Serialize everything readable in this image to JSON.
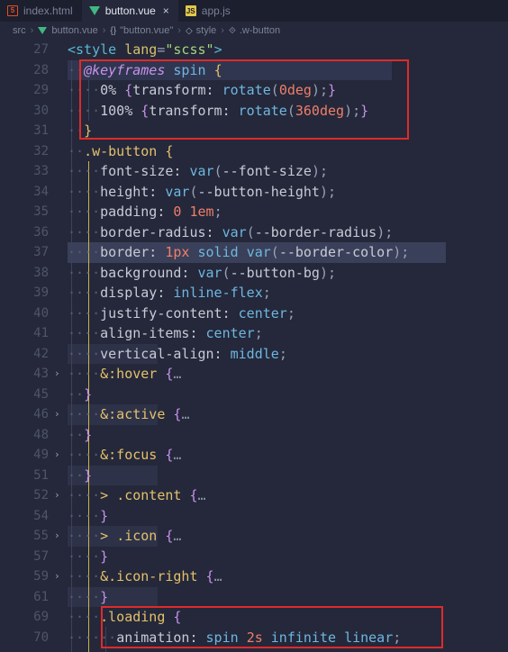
{
  "tabs": [
    {
      "label": "index.html",
      "icon": "html5-icon",
      "active": false
    },
    {
      "label": "button.vue",
      "icon": "vue-icon",
      "active": true
    },
    {
      "label": "app.js",
      "icon": "js-icon",
      "active": false
    }
  ],
  "breadcrumb": {
    "folder": "src",
    "file": "button.vue",
    "component": "\"button.vue\"",
    "block": "style",
    "selector": ".w-button"
  },
  "lines": [
    {
      "n": "27",
      "text": "<style lang=\"scss\">"
    },
    {
      "n": "28",
      "text": "@keyframes spin {"
    },
    {
      "n": "29",
      "text": "0% {transform: rotate(0deg);}"
    },
    {
      "n": "30",
      "text": "100% {transform: rotate(360deg);}"
    },
    {
      "n": "31",
      "text": "}"
    },
    {
      "n": "32",
      "text": ".w-button {"
    },
    {
      "n": "33",
      "text": "font-size: var(--font-size);"
    },
    {
      "n": "34",
      "text": "height: var(--button-height);"
    },
    {
      "n": "35",
      "text": "padding: 0 1em;"
    },
    {
      "n": "36",
      "text": "border-radius: var(--border-radius);"
    },
    {
      "n": "37",
      "text": "border: 1px solid var(--border-color);"
    },
    {
      "n": "38",
      "text": "background: var(--button-bg);"
    },
    {
      "n": "39",
      "text": "display: inline-flex;"
    },
    {
      "n": "40",
      "text": "justify-content: center;"
    },
    {
      "n": "41",
      "text": "align-items: center;"
    },
    {
      "n": "42",
      "text": "vertical-align: middle;"
    },
    {
      "n": "43",
      "text": "&:hover {…"
    },
    {
      "n": "45",
      "text": "}"
    },
    {
      "n": "46",
      "text": "&:active {…"
    },
    {
      "n": "48",
      "text": "}"
    },
    {
      "n": "49",
      "text": "&:focus {…"
    },
    {
      "n": "51",
      "text": "}"
    },
    {
      "n": "52",
      "text": "> .content {…"
    },
    {
      "n": "54",
      "text": "}"
    },
    {
      "n": "55",
      "text": "> .icon {…"
    },
    {
      "n": "57",
      "text": "}"
    },
    {
      "n": "59",
      "text": "&.icon-right {…"
    },
    {
      "n": "61",
      "text": "}"
    },
    {
      "n": "69",
      "text": ".loading {"
    },
    {
      "n": "70",
      "text": "animation: spin 2s infinite linear;"
    }
  ],
  "colors": {
    "background": "#24283a",
    "tabbar": "#1c1f2d",
    "highlight_box": "#e02a2a",
    "property": "#c8cad6",
    "function": "#6fb7e0",
    "number": "#f07e6a",
    "selector": "#e5c06b",
    "keyword_at": "#c792ea"
  }
}
